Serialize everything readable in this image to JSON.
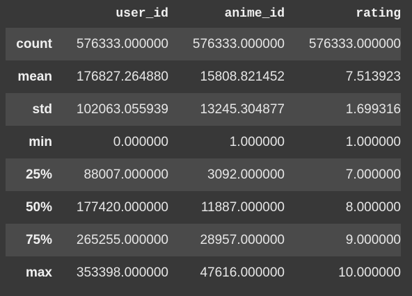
{
  "table": {
    "columns": [
      "user_id",
      "anime_id",
      "rating"
    ],
    "rows": [
      {
        "label": "count",
        "values": [
          "576333.000000",
          "576333.000000",
          "576333.000000"
        ]
      },
      {
        "label": "mean",
        "values": [
          "176827.264880",
          "15808.821452",
          "7.513923"
        ]
      },
      {
        "label": "std",
        "values": [
          "102063.055939",
          "13245.304877",
          "1.699316"
        ]
      },
      {
        "label": "min",
        "values": [
          "0.000000",
          "1.000000",
          "1.000000"
        ]
      },
      {
        "label": "25%",
        "values": [
          "88007.000000",
          "3092.000000",
          "7.000000"
        ]
      },
      {
        "label": "50%",
        "values": [
          "177420.000000",
          "11887.000000",
          "8.000000"
        ]
      },
      {
        "label": "75%",
        "values": [
          "265255.000000",
          "28957.000000",
          "9.000000"
        ]
      },
      {
        "label": "max",
        "values": [
          "353398.000000",
          "47616.000000",
          "10.000000"
        ]
      }
    ]
  }
}
